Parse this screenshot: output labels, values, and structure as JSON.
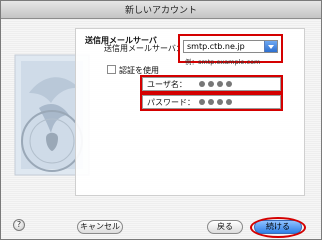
{
  "window": {
    "title": "新しいアカウント"
  },
  "section": {
    "title": "送信用メールサーバ"
  },
  "smtp": {
    "label": "送信用メールサーバ：",
    "value": "smtp.ctb.ne.jp",
    "example": "例：smtp.example.com"
  },
  "auth": {
    "checkbox_label": "認証を使用",
    "checked": false,
    "username_label": "ユーザ名：",
    "password_label": "パスワード："
  },
  "buttons": {
    "help": "?",
    "cancel": "キャンセル",
    "back": "戻る",
    "continue": "続ける"
  },
  "colors": {
    "highlight": "#d40000",
    "accent": "#2f7fe6"
  },
  "icons": {
    "stamp": "mail-stamp-eagle-icon",
    "help": "help-icon",
    "select_arrow": "chevron-down-icon"
  }
}
